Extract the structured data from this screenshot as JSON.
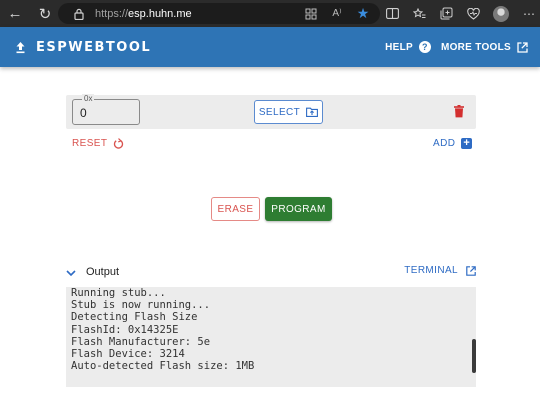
{
  "browser": {
    "url_protocol": "https://",
    "url_host": "esp.huhn.me",
    "read_aloud_label": "A⁾",
    "back_glyph": "←",
    "refresh_glyph": "↻",
    "more_glyph": "⋯"
  },
  "header": {
    "brand": "ESPWEBTOOL",
    "help_label": "HELP",
    "more_tools_label": "MORE TOOLS"
  },
  "partition": {
    "offset_label": "0x",
    "offset_value": "0",
    "select_label": "SELECT"
  },
  "actions": {
    "reset_label": "RESET",
    "add_label": "ADD",
    "erase_label": "ERASE",
    "program_label": "PROGRAM"
  },
  "output": {
    "title": "Output",
    "terminal_label": "TERMINAL",
    "lines": [
      "Running stub...",
      "Stub is now running...",
      "Detecting Flash Size",
      "FlashId: 0x14325E",
      "Flash Manufacturer: 5e",
      "Flash Device: 3214",
      "Auto-detected Flash size: 1MB"
    ]
  },
  "colors": {
    "header_bg": "#2e74b5",
    "program_bg": "#2e7d32",
    "danger": "#d9534f",
    "accent_blue": "#2e6bc4"
  }
}
